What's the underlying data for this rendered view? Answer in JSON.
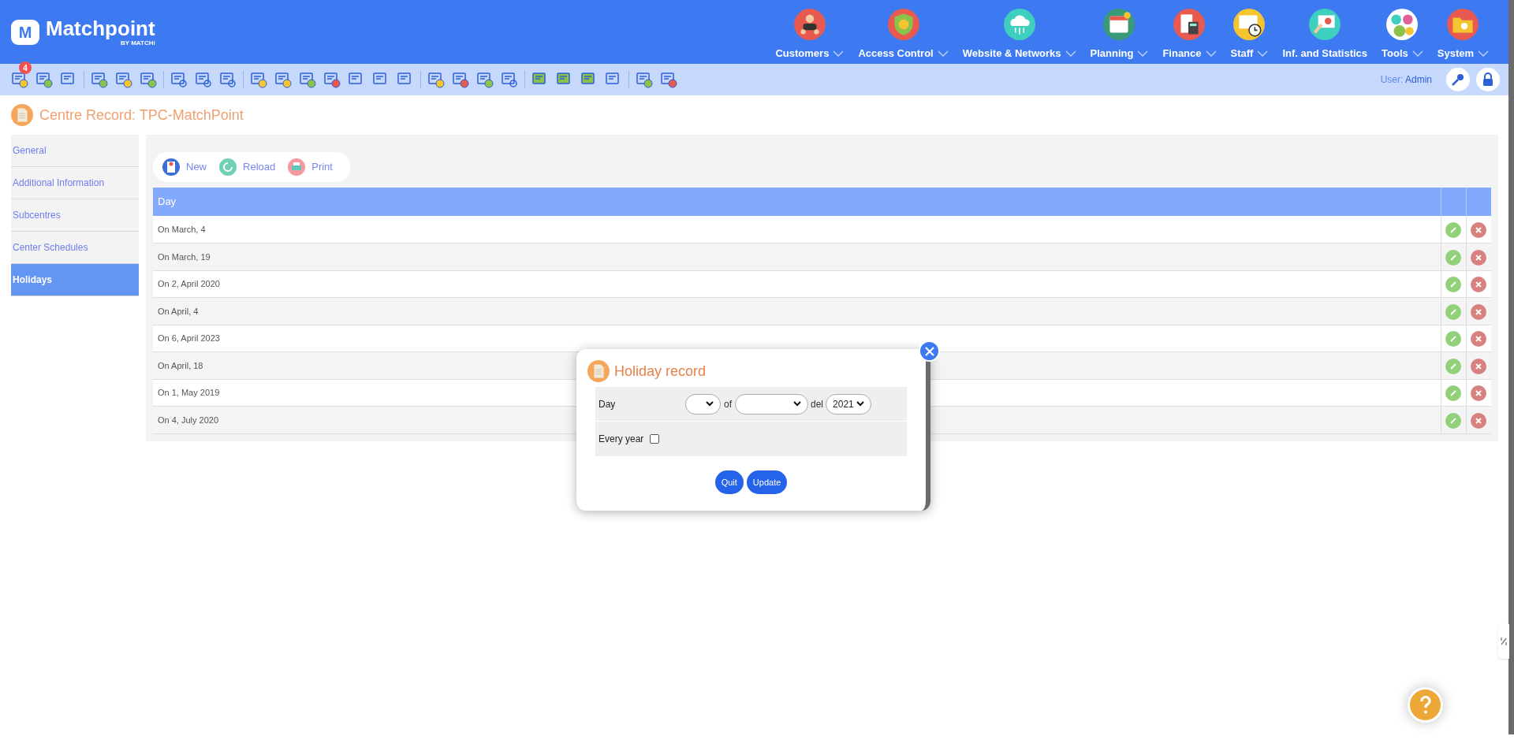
{
  "header": {
    "logo_letter": "M",
    "logo_text": "Matchpoint",
    "logo_sub": "BY MATCHi"
  },
  "nav": [
    {
      "label": "Customers",
      "has_menu": true
    },
    {
      "label": "Access Control",
      "has_menu": true
    },
    {
      "label": "Website & Networks",
      "has_menu": true
    },
    {
      "label": "Planning",
      "has_menu": true
    },
    {
      "label": "Finance",
      "has_menu": true
    },
    {
      "label": "Staff",
      "has_menu": true
    },
    {
      "label": "Inf. and Statistics",
      "has_menu": false
    },
    {
      "label": "Tools",
      "has_menu": true
    },
    {
      "label": "System",
      "has_menu": true
    }
  ],
  "toolbar": {
    "badge": "4",
    "user_label": "User:",
    "user_name": "Admin"
  },
  "page_title": "Centre Record: TPC-MatchPoint",
  "sidebar": {
    "items": [
      {
        "label": "General",
        "selected": false
      },
      {
        "label": "Additional Information",
        "selected": false
      },
      {
        "label": "Subcentres",
        "selected": false
      },
      {
        "label": "Center Schedules",
        "selected": false
      },
      {
        "label": "Holidays",
        "selected": true
      }
    ]
  },
  "actions": [
    "New",
    "Reload",
    "Print"
  ],
  "table": {
    "columns": [
      "Day"
    ],
    "rows": [
      "On March, 4",
      "On March, 19",
      "On 2, April 2020",
      "On April, 4",
      "On 6, April 2023",
      "On April, 18",
      "On 1, May 2019",
      "On 4, July 2020"
    ]
  },
  "dialog": {
    "title": "Holiday record",
    "day_label": "Day",
    "of_label": "of",
    "del_label": "del",
    "year_value": "2021",
    "every_year_label": "Every year",
    "every_year_checked": false,
    "buttons": [
      "Quit",
      "Update"
    ]
  }
}
